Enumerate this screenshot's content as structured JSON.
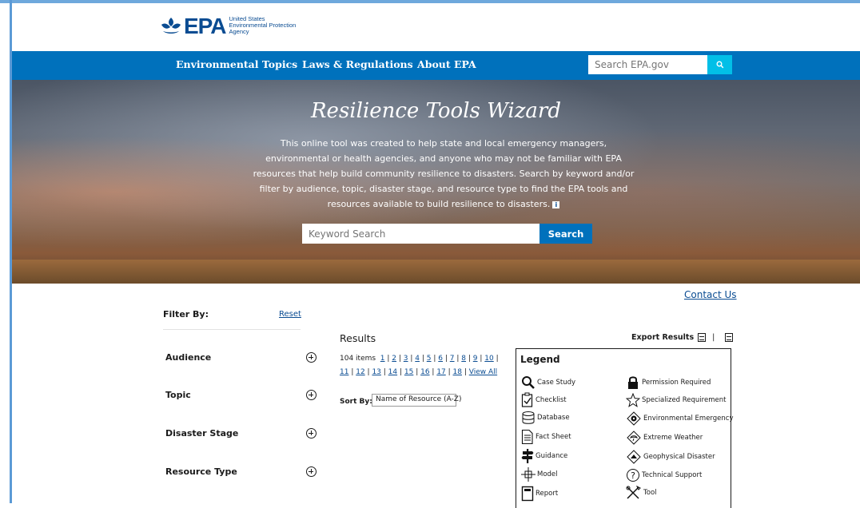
{
  "header": {
    "logo_text": "EPA",
    "logo_sub_1": "United States",
    "logo_sub_2": "Environmental Protection",
    "logo_sub_3": "Agency"
  },
  "nav": {
    "items": [
      "Environmental Topics",
      "Laws & Regulations",
      "About EPA"
    ],
    "search_placeholder": "Search EPA.gov"
  },
  "hero": {
    "title": "Resilience Tools Wizard",
    "description": "This online tool was created to help state and local emergency managers, environmental or health agencies, and anyone who may not be familiar with EPA resources that help build community resilience to disasters. Search by keyword and/or filter by audience, topic, disaster stage, and resource type to find the EPA tools and resources available to build resilience to disasters.",
    "info_icon_glyph": "i",
    "keyword_placeholder": "Keyword Search",
    "search_label": "Search"
  },
  "contact_us": "Contact Us",
  "filters": {
    "label": "Filter By:",
    "reset": "Reset",
    "facets": [
      "Audience",
      "Topic",
      "Disaster Stage",
      "Resource Type"
    ]
  },
  "results": {
    "title": "Results",
    "export_label": "Export Results",
    "export_sep": "|",
    "items_count": "104 items",
    "pages": [
      "1",
      "2",
      "3",
      "4",
      "5",
      "6",
      "7",
      "8",
      "9",
      "10",
      "11",
      "12",
      "13",
      "14",
      "15",
      "16",
      "17",
      "18"
    ],
    "view_all": "View All",
    "sort_label": "Sort By:",
    "sort_value": "Name of Resource (A-Z)"
  },
  "legend": {
    "title": "Legend",
    "left": [
      {
        "label": "Case Study",
        "icon": "magnifier-icon"
      },
      {
        "label": "Checklist",
        "icon": "checklist-icon"
      },
      {
        "label": "Database",
        "icon": "database-icon"
      },
      {
        "label": "Fact Sheet",
        "icon": "fact-sheet-icon"
      },
      {
        "label": "Guidance",
        "icon": "signpost-icon"
      },
      {
        "label": "Model",
        "icon": "model-icon"
      },
      {
        "label": "Report",
        "icon": "report-icon"
      }
    ],
    "right": [
      {
        "label": "Permission Required",
        "icon": "lock-icon"
      },
      {
        "label": "Specialized Requirement",
        "icon": "star-icon"
      },
      {
        "label": "Environmental Emergency",
        "icon": "hazard-icon"
      },
      {
        "label": "Extreme Weather",
        "icon": "weather-icon"
      },
      {
        "label": "Geophysical Disaster",
        "icon": "geophysical-icon"
      },
      {
        "label": "Technical Support",
        "icon": "question-icon"
      },
      {
        "label": "Tool",
        "icon": "tools-icon"
      }
    ]
  },
  "colors": {
    "brand_blue": "#0071bc",
    "link_blue": "#0a4c92",
    "search_cyan": "#02bfe7"
  }
}
